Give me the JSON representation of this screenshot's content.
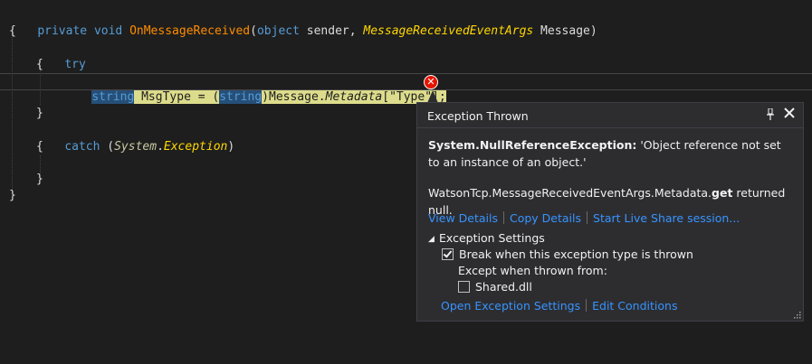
{
  "code": {
    "line1": {
      "kw_private": "private",
      "kw_void": "void",
      "method": "OnMessageReceived",
      "paren_open": "(",
      "kw_object": "object",
      "sender": " sender, ",
      "event_type": "MessageReceivedEventArgs",
      "param_name": " Message",
      "paren_close": ")"
    },
    "open_brace_1": "{",
    "try_kw": "try",
    "open_brace_2": "{",
    "statement": {
      "kw_string": "string",
      "var_decl": " MsgType = (",
      "cast_string": "string",
      "message_prefix": ")Message.",
      "metadata": "Metadata",
      "indexer": "[\"Type\"];"
    },
    "close_brace_2": "}",
    "catch_kw": "catch",
    "catch_open": " (",
    "ns_system": "System",
    "dot": ".",
    "exception_type": "Exception",
    "catch_close": ")",
    "open_brace_3": "{",
    "close_brace_3": "}",
    "close_brace_1": "}"
  },
  "popup": {
    "title": "Exception Thrown",
    "pin_icon": "pin-icon",
    "close_icon": "close-icon",
    "exception_name": "System.NullReferenceException:",
    "exception_message": " 'Object reference not set to an instance of an object.'",
    "detail_prefix": "WatsonTcp.MessageReceivedEventArgs.Metadata.",
    "detail_get": "get",
    "detail_suffix": " returned null.",
    "links": {
      "view_details": "View Details",
      "copy_details": "Copy Details",
      "live_share": "Start Live Share session..."
    },
    "settings": {
      "heading": "Exception Settings",
      "break_when": "Break when this exception type is thrown",
      "break_checked": true,
      "except_when": "Except when thrown from:",
      "module": "Shared.dll",
      "module_checked": false
    },
    "footer_links": {
      "open_settings": "Open Exception Settings",
      "edit_conditions": "Edit Conditions"
    }
  },
  "colors": {
    "editor_bg": "#1e1e1e",
    "keyword": "#569cd6",
    "method": "#ff8c00",
    "type": "#ffd700",
    "statement_highlight": "#dcdc8c",
    "popup_bg": "#2d2d30",
    "link": "#3794ff",
    "error": "#e51400"
  }
}
